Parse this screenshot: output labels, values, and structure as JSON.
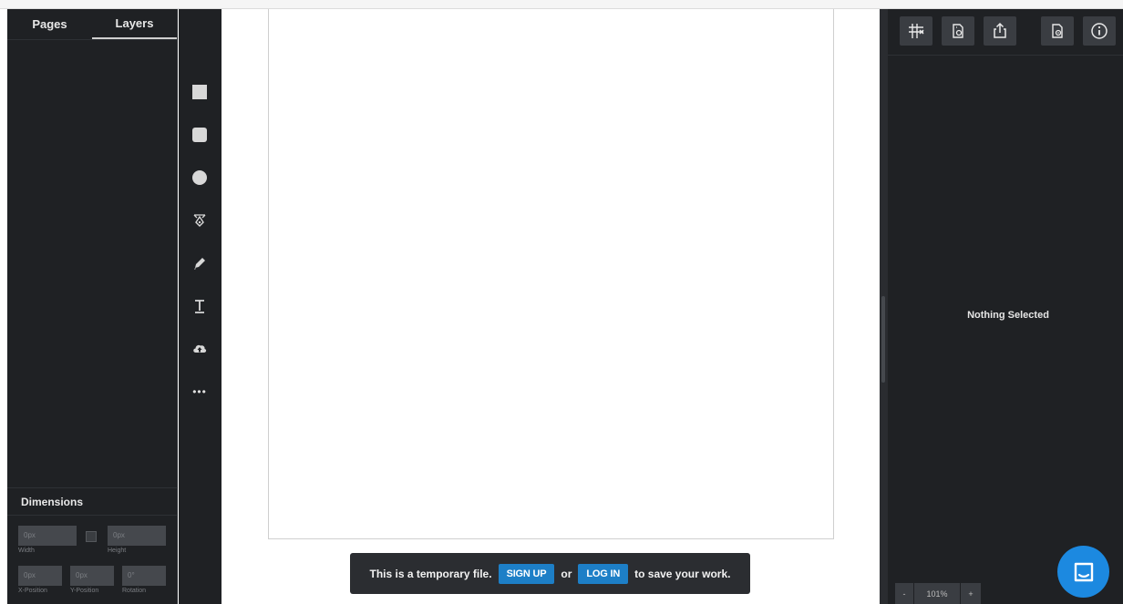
{
  "left_panel": {
    "tabs": [
      {
        "label": "Pages"
      },
      {
        "label": "Layers"
      }
    ],
    "dimensions": {
      "title": "Dimensions",
      "width": {
        "value": "0px",
        "label": "Width"
      },
      "height": {
        "value": "0px",
        "label": "Height"
      },
      "x_position": {
        "value": "0px",
        "label": "X-Position"
      },
      "y_position": {
        "value": "0px",
        "label": "Y-Position"
      },
      "rotation": {
        "value": "0°",
        "label": "Rotation"
      }
    }
  },
  "tools": [
    {
      "icon": "rectangle-icon"
    },
    {
      "icon": "rounded-rectangle-icon"
    },
    {
      "icon": "ellipse-icon"
    },
    {
      "icon": "vector-pen-icon"
    },
    {
      "icon": "pencil-icon"
    },
    {
      "icon": "text-icon"
    },
    {
      "icon": "upload-icon"
    },
    {
      "icon": "more-icon",
      "glyph": "•••"
    }
  ],
  "banner": {
    "text_before": "This is a temporary file.",
    "signup_label": "SIGN UP",
    "or_text": "or",
    "login_label": "LOG IN",
    "text_after": "to save your work."
  },
  "right_panel": {
    "toolbar_icons": [
      "grid-icon",
      "duplicate-page-icon",
      "export-icon",
      "page-settings-icon",
      "info-icon"
    ],
    "empty_message": "Nothing Selected",
    "zoom": {
      "minus": "-",
      "level": "101%",
      "plus": "+"
    }
  },
  "colors": {
    "panel_bg": "#1f2124",
    "accent_blue": "#1d7fc7",
    "chat_blue": "#1c89e0"
  }
}
